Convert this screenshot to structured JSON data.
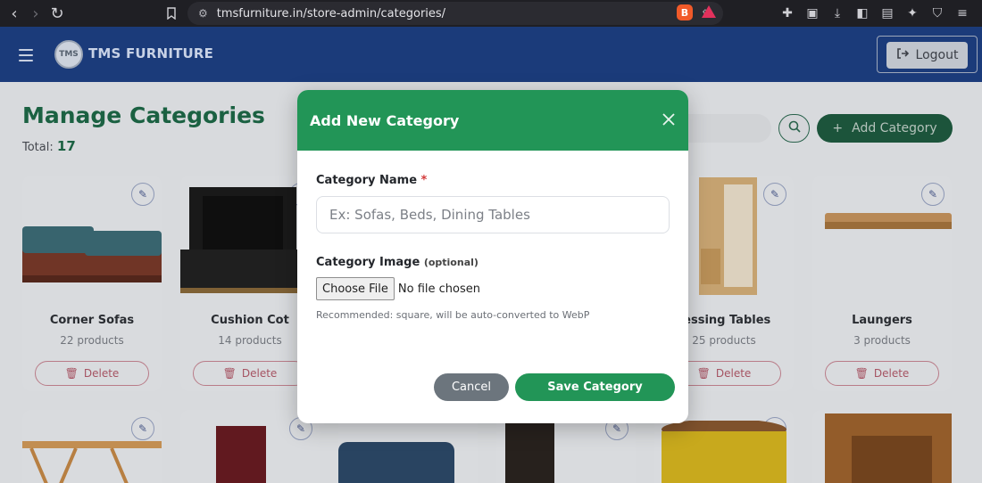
{
  "browser": {
    "url": "tmsfurniture.in/store-admin/categories/"
  },
  "header": {
    "logo_text": "TMS",
    "brand": "TMS FURNITURE",
    "logout_label": "Logout"
  },
  "page": {
    "title": "Manage Categories",
    "total_label": "Total:",
    "total_count": "17",
    "add_category_label": "Add Category"
  },
  "cards_row1": [
    {
      "name": "Corner Sofas",
      "count": "22 products",
      "delete_label": "Delete"
    },
    {
      "name": "Cushion Cot",
      "count": "14 products",
      "delete_label": "Delete"
    },
    {
      "name": "",
      "count": "",
      "delete_label": ""
    },
    {
      "name": "",
      "count": "",
      "delete_label": ""
    },
    {
      "name": "ressing Tables",
      "count": "25 products",
      "delete_label": "Delete"
    },
    {
      "name": "Laungers",
      "count": "3 products",
      "delete_label": "Delete"
    }
  ],
  "modal": {
    "title": "Add New Category",
    "name_label": "Category Name",
    "required_mark": "*",
    "name_placeholder": "Ex: Sofas, Beds, Dining Tables",
    "name_value": "",
    "image_label": "Category Image",
    "image_optional": "(optional)",
    "choose_file_label": "Choose File",
    "no_file_text": "No file chosen",
    "hint": "Recommended: square, will be auto-converted to WebP",
    "cancel_label": "Cancel",
    "save_label": "Save Category"
  },
  "colors": {
    "header_bg": "#1b3b7a",
    "primary_green": "#229557",
    "title_green": "#1e6a48",
    "cancel_gray": "#6c757d",
    "delete_red": "#b45b6b"
  }
}
